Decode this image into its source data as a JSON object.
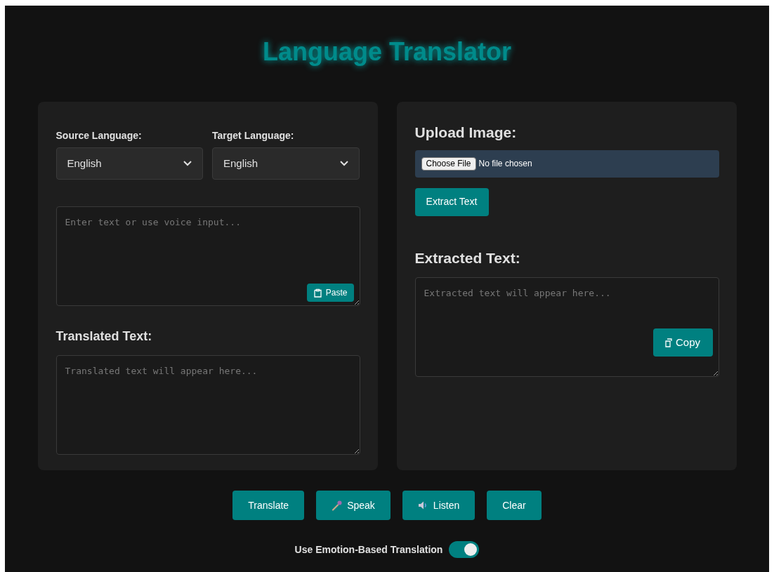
{
  "title": "Language Translator",
  "source_language": {
    "label": "Source Language:",
    "value": "English"
  },
  "target_language": {
    "label": "Target Language:",
    "value": "English"
  },
  "input": {
    "placeholder": "Enter text or use voice input...",
    "paste_button": "Paste"
  },
  "translated": {
    "heading": "Translated Text:",
    "placeholder": "Translated text will appear here..."
  },
  "upload": {
    "heading": "Upload Image:",
    "file_button": "Choose File",
    "file_status": "No file chosen",
    "extract_button": "Extract Text"
  },
  "extracted": {
    "heading": "Extracted Text:",
    "placeholder": "Extracted text will appear here...",
    "copy_button": "Copy"
  },
  "actions": [
    {
      "label": "Translate",
      "kind": "plain"
    },
    {
      "label": "Speak",
      "kind": "microphone"
    },
    {
      "label": "Listen",
      "kind": "speaker"
    },
    {
      "label": "Clear",
      "kind": "plain"
    }
  ],
  "toggle": {
    "label": "Use Emotion-Based Translation",
    "on": true
  }
}
